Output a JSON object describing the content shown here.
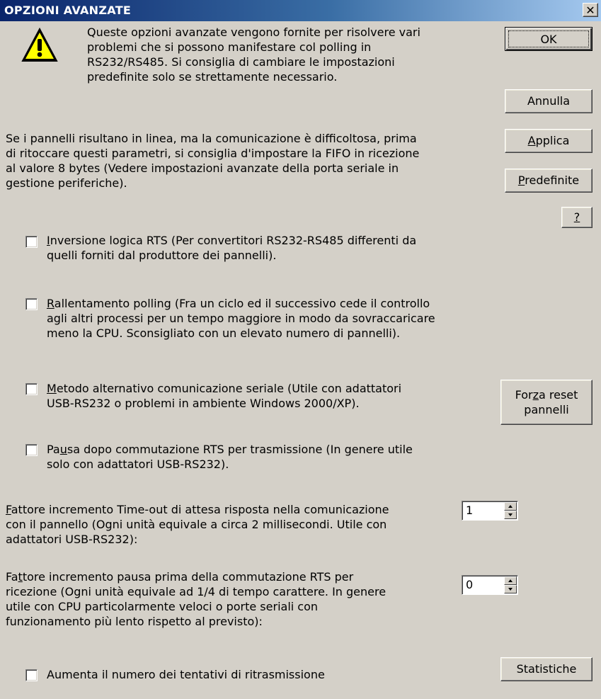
{
  "window": {
    "title": "OPZIONI AVANZATE",
    "close_glyph": "✕",
    "close_icon": "close-icon"
  },
  "intro": {
    "icon": "warning-icon",
    "line1": "Queste opzioni avanzate vengono fornite per risolvere vari",
    "line2": "problemi che si possono manifestare col polling in",
    "line3": "RS232/RS485. Si consiglia di cambiare le impostazioni",
    "line4": "predefinite solo se strettamente necessario."
  },
  "note": {
    "line1": "Se i pannelli risultano in linea, ma la comunicazione è difficoltosa, prima",
    "line2": "di ritoccare questi parametri, si consiglia d'impostare la FIFO in ricezione",
    "line3": "al valore 8 bytes (Vedere impostazioni avanzate della porta seriale in",
    "line4": "gestione periferiche)."
  },
  "buttons": {
    "ok": "OK",
    "annulla": "Annulla",
    "applica_key": "A",
    "applica_rest": "pplica",
    "predefinite_key": "P",
    "predefinite_rest": "redefinite",
    "help": "?",
    "forza_line1_pre": "For",
    "forza_line1_key": "z",
    "forza_line1_post": "a reset",
    "forza_line2": "pannelli",
    "statistiche": "Statistiche"
  },
  "options": [
    {
      "checked": false,
      "key": "I",
      "line1_rest": "nversione logica RTS (Per convertitori RS232-RS485 differenti da",
      "line2": "quelli forniti dal produttore dei pannelli)."
    },
    {
      "checked": false,
      "key": "R",
      "line1_rest": "allentamento polling (Fra un ciclo ed il successivo cede il controllo",
      "line2": "agli altri processi per un tempo maggiore in modo da sovraccaricare",
      "line3": "meno la CPU. Sconsigliato con un elevato numero di pannelli)."
    },
    {
      "checked": false,
      "key": "M",
      "line1_rest": "etodo alternativo comunicazione seriale (Utile con adattatori",
      "line2": "USB-RS232 o problemi in ambiente Windows 2000/XP)."
    },
    {
      "checked": false,
      "pre": "Pa",
      "key": "u",
      "line1_rest": "sa dopo commutazione RTS per trasmissione (In genere utile",
      "line2": "solo con adattatori USB-RS232)."
    },
    {
      "checked": false,
      "line1": "Aumenta il numero dei tentativi di ritrasmissione"
    }
  ],
  "timeout": {
    "key": "F",
    "line1_rest": "attore incremento Time-out di attesa risposta nella comunicazione",
    "line2": "con il pannello (Ogni unità equivale a circa 2 millisecondi. Utile con",
    "line3": "adattatori USB-RS232):",
    "value": "1"
  },
  "pause": {
    "pre": "Fa",
    "key": "t",
    "line1_rest": "tore incremento pausa prima della commutazione RTS per",
    "line2": "ricezione (Ogni unità equivale ad 1/4 di tempo carattere. In genere",
    "line3": "utile con CPU particolarmente veloci o porte seriali con",
    "line4": "funzionamento più lento rispetto al previsto):",
    "value": "0"
  }
}
